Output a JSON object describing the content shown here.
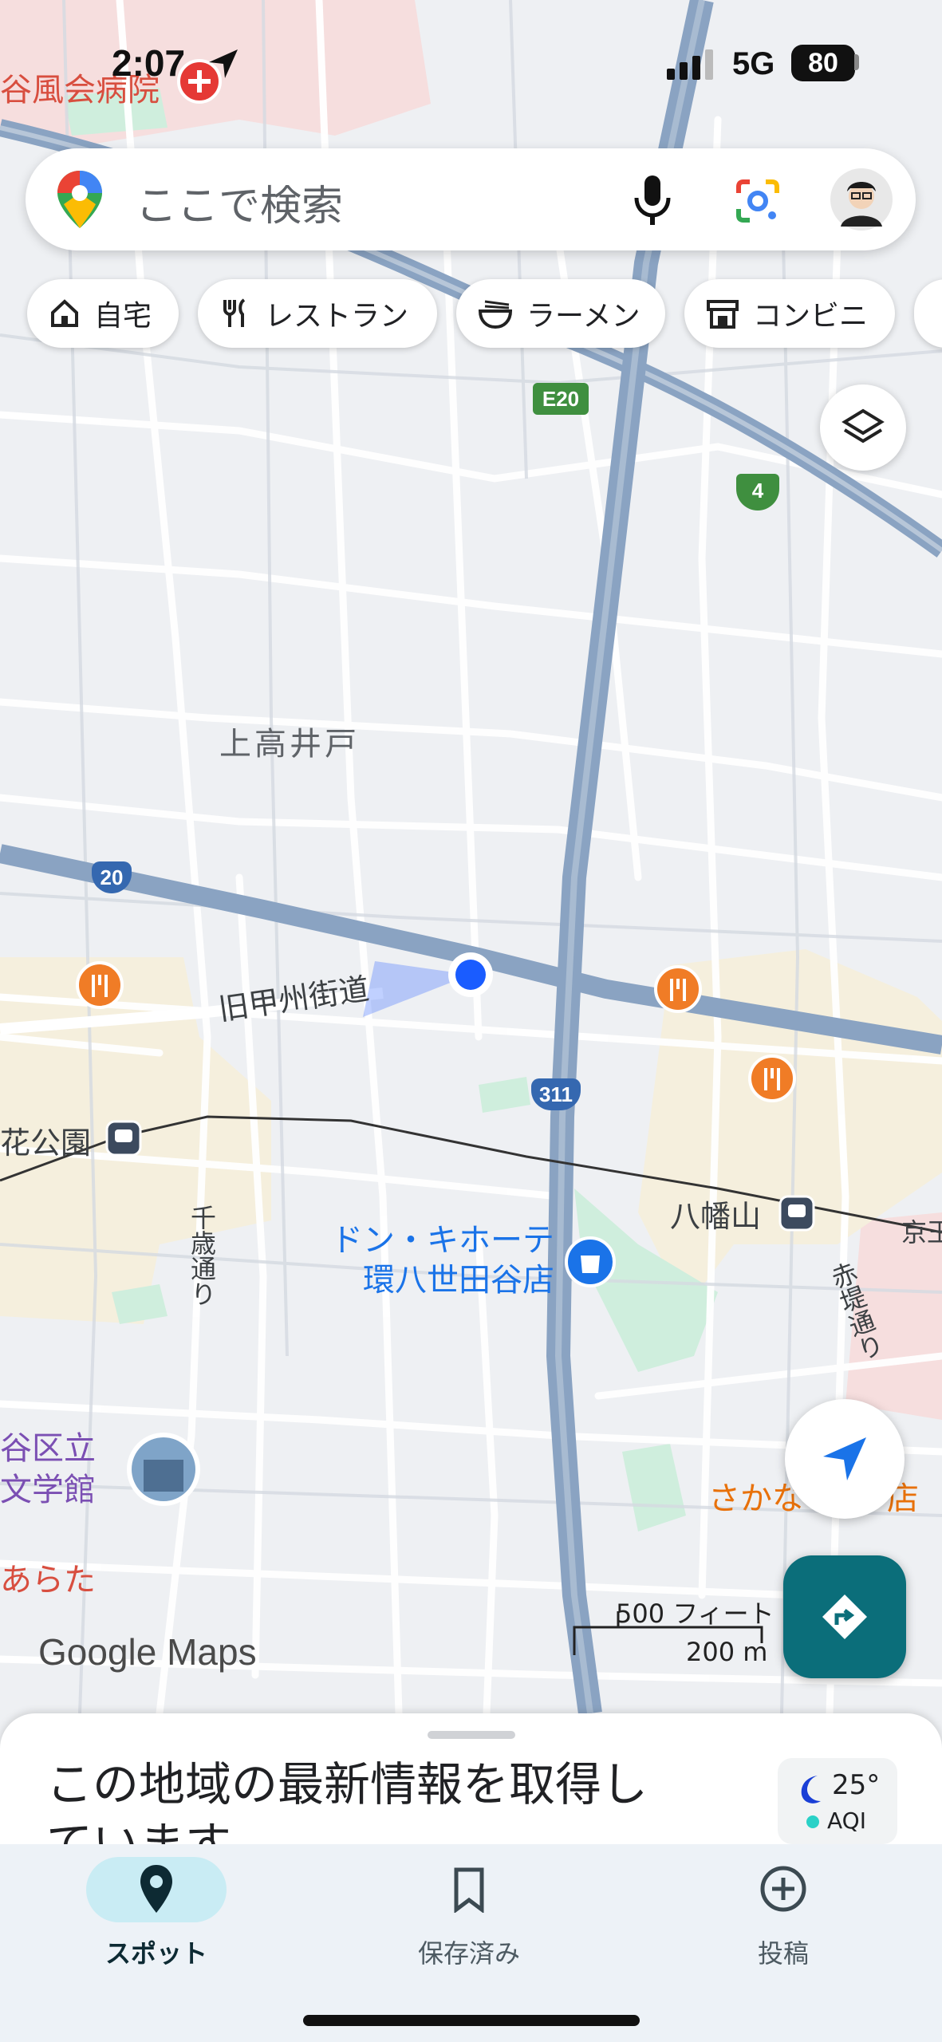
{
  "status_bar": {
    "time": "2:07",
    "network": "5G",
    "battery": "80"
  },
  "search": {
    "placeholder": "ここで検索"
  },
  "chips": [
    {
      "label": "自宅",
      "icon": "home-icon"
    },
    {
      "label": "レストラン",
      "icon": "restaurant-icon"
    },
    {
      "label": "ラーメン",
      "icon": "ramen-icon"
    },
    {
      "label": "コンビニ",
      "icon": "store-icon"
    }
  ],
  "map": {
    "area_labels": {
      "kamitakaido": "上高井戸"
    },
    "road_labels": {
      "koshu_kaido": "旧甲州街道",
      "chitose_dori": "千歳通り",
      "akatsutsumi_dori": "赤堤通り"
    },
    "station_labels": {
      "hachimanyama": "八幡山",
      "roka_koen": "花公園",
      "keio_cut": "京王"
    },
    "pois": {
      "hospital_label": "谷風会病院",
      "donki_line1": "ドン・キホーテ",
      "donki_line2": "環八世田谷店",
      "museum_line1": "谷区立",
      "museum_line2": "文学館",
      "sakana_label": "さかな",
      "sakana_suffix": "店",
      "arata_label": "あらた"
    },
    "shields": {
      "e20": "E20",
      "r4": "4",
      "r20": "20",
      "r311": "311"
    },
    "scale": {
      "feet": "500 フィート",
      "meters": "200 m"
    },
    "attribution": "Google Maps"
  },
  "sheet": {
    "text": "この地域の最新情報を取得しています...",
    "temperature": "25°",
    "aqi": "AQI"
  },
  "nav": {
    "explore": "スポット",
    "saved": "保存済み",
    "contribute": "投稿"
  },
  "colors": {
    "highway": "#8aa3c2",
    "accent_teal": "#0b6e7a",
    "location_blue": "#1a5cff",
    "poi_orange": "#f07c26"
  }
}
